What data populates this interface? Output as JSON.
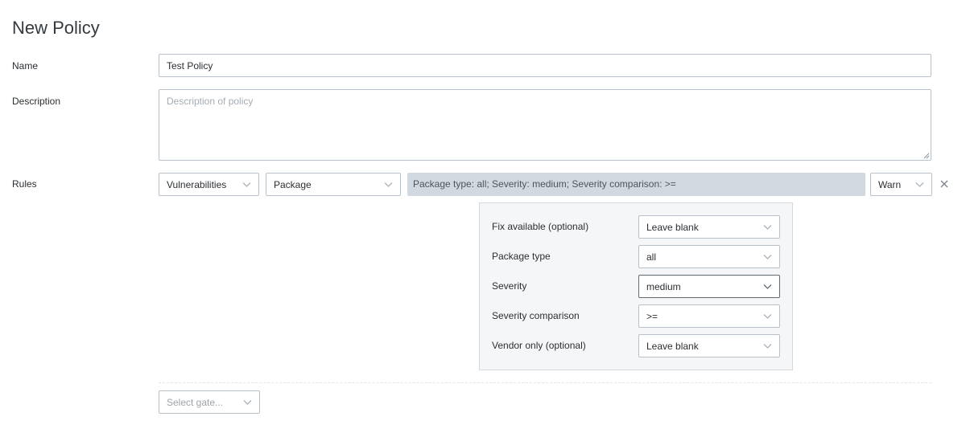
{
  "page": {
    "title": "New Policy"
  },
  "form": {
    "name_label": "Name",
    "name_value": "Test Policy",
    "description_label": "Description",
    "description_placeholder": "Description of policy",
    "rules_label": "Rules"
  },
  "rule": {
    "gate_value": "Vulnerabilities",
    "trigger_value": "Package",
    "summary": "Package type: all; Severity: medium; Severity comparison: >=",
    "action_value": "Warn"
  },
  "params": [
    {
      "label": "Fix available (optional)",
      "value": "Leave blank"
    },
    {
      "label": "Package type",
      "value": "all"
    },
    {
      "label": "Severity",
      "value": "medium"
    },
    {
      "label": "Severity comparison",
      "value": ">="
    },
    {
      "label": "Vendor only (optional)",
      "value": "Leave blank"
    }
  ],
  "add_gate": {
    "placeholder": "Select gate..."
  },
  "icons": {
    "dropdown": "chevron-down-icon",
    "remove": "close-icon",
    "resize": "resize-grip-icon"
  },
  "colors": {
    "border": "#b8c1c9",
    "summary_bg": "#d1d8df",
    "panel_bg": "#f5f6f7",
    "chevron": "#a9b2ba"
  }
}
